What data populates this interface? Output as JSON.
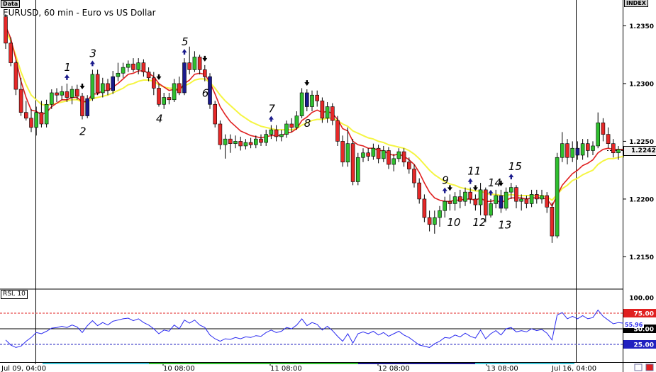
{
  "window": {
    "data_tag": "Data",
    "index_tag": "INDEX",
    "title": "EURUSD, 60 min - Euro vs US Dollar",
    "rsi_tag": "RSI, 10",
    "current_price": "1.2242",
    "rsi_overlay_value": "55.96"
  },
  "colors": {
    "bull": "#2fbf2f",
    "bear": "#e62828",
    "highlight": "#1a1a8c",
    "ema_fast": "#e02020",
    "ema_slow": "#f5f542",
    "rsi_line": "#2a2af0",
    "rsi_75_line": "#e02020",
    "rsi_25_line": "#2020c0",
    "price_tag_bg": "#f0f0f0",
    "rsi_75_tag_bg": "#e02020",
    "rsi_50_tag_bg": "#000000",
    "rsi_25_tag_bg": "#2020c0",
    "arrow_up": "#1a1a8c",
    "arrow_down": "#000000"
  },
  "chart_data": {
    "type": "candlestick",
    "symbol": "EURUSD",
    "timeframe": "60 min",
    "ylim": [
      1.213,
      1.2365
    ],
    "price_ticks": [
      "1.2350",
      "1.2300",
      "1.2250",
      "1.2200",
      "1.2150"
    ],
    "x_labels": [
      "Jul 09, 04:00",
      "10 08:00",
      "11 08:00",
      "12 08:00",
      "13 08:00",
      "Jul 16, 04:00"
    ],
    "candles": [
      [
        1.2358,
        1.2335,
        1.236,
        1.233
      ],
      [
        1.2335,
        1.2318,
        1.234,
        1.2315
      ],
      [
        1.2318,
        1.2295,
        1.232,
        1.229
      ],
      [
        1.2295,
        1.2275,
        1.2305,
        1.2272
      ],
      [
        1.2275,
        1.227,
        1.2285,
        1.2268
      ],
      [
        1.227,
        1.2262,
        1.2278,
        1.2258
      ],
      [
        1.2262,
        1.2275,
        1.228,
        1.2255
      ],
      [
        1.2275,
        1.2265,
        1.2285,
        1.2262
      ],
      [
        1.2265,
        1.2282,
        1.2286,
        1.2262
      ],
      [
        1.2282,
        1.2292,
        1.2295,
        1.2278
      ],
      [
        1.2292,
        1.229,
        1.2296,
        1.2284
      ],
      [
        1.229,
        1.2293,
        1.2298,
        1.2286
      ],
      [
        1.2293,
        1.2288,
        1.23,
        1.2284
      ],
      [
        1.2288,
        1.2295,
        1.2298,
        1.2282
      ],
      [
        1.2295,
        1.2289,
        1.2299,
        1.2286
      ],
      [
        1.2289,
        1.2272,
        1.2292,
        1.2269
      ],
      [
        1.2272,
        1.2287,
        1.229,
        1.227
      ],
      [
        1.2287,
        1.2308,
        1.2312,
        1.2285
      ],
      [
        1.2308,
        1.2292,
        1.2312,
        1.229
      ],
      [
        1.2292,
        1.23,
        1.2305,
        1.2288
      ],
      [
        1.23,
        1.2294,
        1.2304,
        1.229
      ],
      [
        1.2294,
        1.2306,
        1.2311,
        1.2291
      ],
      [
        1.2306,
        1.2309,
        1.2318,
        1.2302
      ],
      [
        1.2309,
        1.2314,
        1.2318,
        1.2305
      ],
      [
        1.2314,
        1.2317,
        1.232,
        1.231
      ],
      [
        1.2317,
        1.2312,
        1.2322,
        1.231
      ],
      [
        1.2312,
        1.2318,
        1.2322,
        1.2308
      ],
      [
        1.2318,
        1.231,
        1.2321,
        1.2306
      ],
      [
        1.231,
        1.2305,
        1.2314,
        1.2302
      ],
      [
        1.2305,
        1.2296,
        1.231,
        1.229
      ],
      [
        1.2296,
        1.2282,
        1.23,
        1.228
      ],
      [
        1.2282,
        1.2288,
        1.2292,
        1.2278
      ],
      [
        1.2288,
        1.2286,
        1.2292,
        1.2282
      ],
      [
        1.2286,
        1.23,
        1.2304,
        1.2284
      ],
      [
        1.23,
        1.2292,
        1.2306,
        1.229
      ],
      [
        1.2292,
        1.2318,
        1.2322,
        1.229
      ],
      [
        1.2318,
        1.2312,
        1.2332,
        1.2308
      ],
      [
        1.2312,
        1.2323,
        1.2328,
        1.231
      ],
      [
        1.2323,
        1.2312,
        1.2325,
        1.2308
      ],
      [
        1.2312,
        1.2306,
        1.2316,
        1.2302
      ],
      [
        1.2306,
        1.2282,
        1.2309,
        1.2278
      ],
      [
        1.2282,
        1.2265,
        1.2285,
        1.2262
      ],
      [
        1.2265,
        1.2247,
        1.2268,
        1.2243
      ],
      [
        1.2247,
        1.2252,
        1.2256,
        1.2235
      ],
      [
        1.2252,
        1.2248,
        1.2256,
        1.224
      ],
      [
        1.2248,
        1.225,
        1.2255,
        1.2244
      ],
      [
        1.225,
        1.2246,
        1.2254,
        1.2242
      ],
      [
        1.2246,
        1.2249,
        1.2252,
        1.2243
      ],
      [
        1.2249,
        1.2247,
        1.2253,
        1.2244
      ],
      [
        1.2247,
        1.2252,
        1.2255,
        1.2244
      ],
      [
        1.2252,
        1.2249,
        1.2256,
        1.2246
      ],
      [
        1.2249,
        1.2256,
        1.226,
        1.2246
      ],
      [
        1.2256,
        1.226,
        1.2264,
        1.2252
      ],
      [
        1.226,
        1.2254,
        1.2264,
        1.225
      ],
      [
        1.2254,
        1.2256,
        1.226,
        1.225
      ],
      [
        1.2256,
        1.2265,
        1.2268,
        1.2253
      ],
      [
        1.2265,
        1.2262,
        1.227,
        1.2258
      ],
      [
        1.2262,
        1.2272,
        1.2276,
        1.226
      ],
      [
        1.2272,
        1.2292,
        1.2296,
        1.227
      ],
      [
        1.2292,
        1.228,
        1.2295,
        1.2276
      ],
      [
        1.228,
        1.229,
        1.2294,
        1.2276
      ],
      [
        1.229,
        1.2285,
        1.2294,
        1.228
      ],
      [
        1.2285,
        1.227,
        1.2288,
        1.2266
      ],
      [
        1.227,
        1.228,
        1.2284,
        1.2266
      ],
      [
        1.228,
        1.2268,
        1.2283,
        1.2264
      ],
      [
        1.2268,
        1.225,
        1.2272,
        1.2246
      ],
      [
        1.225,
        1.2232,
        1.2255,
        1.2228
      ],
      [
        1.2232,
        1.2248,
        1.2262,
        1.2228
      ],
      [
        1.2248,
        1.2215,
        1.2252,
        1.2212
      ],
      [
        1.2215,
        1.2236,
        1.224,
        1.2212
      ],
      [
        1.2236,
        1.224,
        1.2244,
        1.2232
      ],
      [
        1.224,
        1.2237,
        1.2244,
        1.2233
      ],
      [
        1.2237,
        1.2244,
        1.2248,
        1.2234
      ],
      [
        1.2244,
        1.2235,
        1.2247,
        1.2231
      ],
      [
        1.2235,
        1.2242,
        1.2246,
        1.2232
      ],
      [
        1.2242,
        1.223,
        1.2245,
        1.2226
      ],
      [
        1.223,
        1.2235,
        1.2239,
        1.2224
      ],
      [
        1.2235,
        1.2241,
        1.2244,
        1.2232
      ],
      [
        1.2241,
        1.2232,
        1.2244,
        1.2228
      ],
      [
        1.2232,
        1.2226,
        1.2236,
        1.2222
      ],
      [
        1.2226,
        1.2214,
        1.223,
        1.221
      ],
      [
        1.2214,
        1.22,
        1.2218,
        1.2196
      ],
      [
        1.22,
        1.2184,
        1.2204,
        1.218
      ],
      [
        1.2184,
        1.2178,
        1.219,
        1.2172
      ],
      [
        1.2178,
        1.2184,
        1.219,
        1.217
      ],
      [
        1.2184,
        1.219,
        1.2194,
        1.2176
      ],
      [
        1.219,
        1.2198,
        1.2202,
        1.2184
      ],
      [
        1.2198,
        1.2196,
        1.2204,
        1.219
      ],
      [
        1.2196,
        1.2202,
        1.2206,
        1.219
      ],
      [
        1.2202,
        1.2198,
        1.2208,
        1.2192
      ],
      [
        1.2198,
        1.2206,
        1.221,
        1.2194
      ],
      [
        1.2206,
        1.22,
        1.221,
        1.2196
      ],
      [
        1.22,
        1.2195,
        1.2204,
        1.219
      ],
      [
        1.2195,
        1.2208,
        1.2214,
        1.2186
      ],
      [
        1.2208,
        1.2186,
        1.221,
        1.218
      ],
      [
        1.2186,
        1.2196,
        1.22,
        1.2184
      ],
      [
        1.2196,
        1.2203,
        1.2208,
        1.2192
      ],
      [
        1.2203,
        1.2192,
        1.2208,
        1.2188
      ],
      [
        1.2192,
        1.2206,
        1.221,
        1.219
      ],
      [
        1.2206,
        1.221,
        1.2214,
        1.22
      ],
      [
        1.221,
        1.2198,
        1.2212,
        1.2192
      ],
      [
        1.2198,
        1.22,
        1.2204,
        1.219
      ],
      [
        1.22,
        1.2196,
        1.2203,
        1.2192
      ],
      [
        1.2196,
        1.2204,
        1.2208,
        1.2193
      ],
      [
        1.2204,
        1.22,
        1.2208,
        1.2196
      ],
      [
        1.22,
        1.2203,
        1.2208,
        1.2196
      ],
      [
        1.2203,
        1.2193,
        1.2206,
        1.2188
      ],
      [
        1.2193,
        1.2168,
        1.2197,
        1.2162
      ],
      [
        1.2168,
        1.2236,
        1.224,
        1.2166
      ],
      [
        1.2236,
        1.2248,
        1.2258,
        1.2232
      ],
      [
        1.2248,
        1.2236,
        1.2252,
        1.223
      ],
      [
        1.2236,
        1.2244,
        1.225,
        1.2232
      ],
      [
        1.2244,
        1.2238,
        1.225,
        1.2234
      ],
      [
        1.2238,
        1.2248,
        1.2252,
        1.2234
      ],
      [
        1.2248,
        1.2242,
        1.2252,
        1.2236
      ],
      [
        1.2242,
        1.2246,
        1.225,
        1.2238
      ],
      [
        1.2246,
        1.2266,
        1.2275,
        1.2244
      ],
      [
        1.2266,
        1.2256,
        1.227,
        1.225
      ],
      [
        1.2256,
        1.2248,
        1.2262,
        1.2244
      ],
      [
        1.2248,
        1.224,
        1.2252,
        1.2236
      ],
      [
        1.224,
        1.2243,
        1.2246,
        1.2234
      ],
      [
        1.2243,
        1.2242,
        1.2246,
        1.2236
      ]
    ],
    "highlighted_candles": [
      16,
      21,
      35,
      40,
      59,
      97,
      112
    ],
    "ema_fast": [
      1.235,
      1.2339,
      1.2321,
      1.2302,
      1.2288,
      1.2277,
      1.2276,
      1.2273,
      1.2275,
      1.228,
      1.2283,
      1.2286,
      1.2286,
      1.2288,
      1.2288,
      1.2284,
      1.2285,
      1.2291,
      1.2291,
      1.2294,
      1.2294,
      1.2297,
      1.23,
      1.2304,
      1.2308,
      1.2309,
      1.2311,
      1.2311,
      1.2309,
      1.2306,
      1.23,
      1.2297,
      1.2294,
      1.2295,
      1.2294,
      1.23,
      1.2303,
      1.2308,
      1.2309,
      1.2308,
      1.2301,
      1.2291,
      1.228,
      1.2273,
      1.2267,
      1.2263,
      1.2259,
      1.2257,
      1.2255,
      1.2254,
      1.2253,
      1.2254,
      1.2255,
      1.2255,
      1.2255,
      1.2257,
      1.2258,
      1.2261,
      1.2268,
      1.2271,
      1.2275,
      1.2277,
      1.2275,
      1.2276,
      1.2274,
      1.2269,
      1.2261,
      1.2259,
      1.225,
      1.2247,
      1.2246,
      1.2244,
      1.2244,
      1.2242,
      1.2242,
      1.2239,
      1.2238,
      1.2239,
      1.2237,
      1.2234,
      1.223,
      1.2223,
      1.2214,
      1.2206,
      1.2201,
      1.2199,
      1.2198,
      1.2198,
      1.2199,
      1.2199,
      1.22,
      1.22,
      1.2199,
      1.2201,
      1.2198,
      1.2198,
      1.2199,
      1.2197,
      1.2199,
      1.2201,
      1.2201,
      1.2201,
      1.22,
      1.2201,
      1.2201,
      1.2201,
      1.22,
      1.2194,
      1.2203,
      1.2212,
      1.2217,
      1.2222,
      1.2225,
      1.2229,
      1.2231,
      1.2234,
      1.224,
      1.2243,
      1.2244,
      1.2243,
      1.2243,
      1.2243
    ],
    "ema_slow": [
      1.2345,
      1.2337,
      1.2324,
      1.231,
      1.2299,
      1.229,
      1.2286,
      1.2282,
      1.2281,
      1.2282,
      1.2283,
      1.2284,
      1.2285,
      1.2286,
      1.2286,
      1.2284,
      1.2284,
      1.2287,
      1.2288,
      1.2289,
      1.229,
      1.2292,
      1.2294,
      1.2296,
      1.2299,
      1.23,
      1.2302,
      1.2303,
      1.2303,
      1.2302,
      1.2299,
      1.2297,
      1.2296,
      1.2296,
      1.2295,
      1.2298,
      1.23,
      1.2303,
      1.2304,
      1.2304,
      1.2301,
      1.2296,
      1.229,
      1.2285,
      1.2281,
      1.2277,
      1.2273,
      1.227,
      1.2267,
      1.2265,
      1.2263,
      1.2262,
      1.2261,
      1.226,
      1.226,
      1.226,
      1.226,
      1.2261,
      1.2264,
      1.2266,
      1.2268,
      1.2269,
      1.2269,
      1.227,
      1.227,
      1.2268,
      1.2265,
      1.2263,
      1.2259,
      1.2257,
      1.2255,
      1.2253,
      1.2252,
      1.225,
      1.2249,
      1.2247,
      1.2246,
      1.2245,
      1.2244,
      1.2242,
      1.2239,
      1.2235,
      1.223,
      1.2225,
      1.2221,
      1.2218,
      1.2215,
      1.2213,
      1.2212,
      1.221,
      1.2209,
      1.2208,
      1.2207,
      1.2207,
      1.2205,
      1.2204,
      1.2204,
      1.2203,
      1.2203,
      1.2204,
      1.2203,
      1.2203,
      1.2203,
      1.2203,
      1.2203,
      1.2203,
      1.2202,
      1.2199,
      1.2204,
      1.2209,
      1.2212,
      1.2216,
      1.2218,
      1.2221,
      1.2223,
      1.2225,
      1.223,
      1.2233,
      1.2235,
      1.2235,
      1.2236,
      1.2237
    ],
    "markers": [
      {
        "label": "1",
        "index": 12,
        "dir": "up"
      },
      {
        "label": "2",
        "index": 15,
        "dir": "down"
      },
      {
        "label": "3",
        "index": 17,
        "dir": "up"
      },
      {
        "label": "4",
        "index": 30,
        "dir": "down"
      },
      {
        "label": "5",
        "index": 35,
        "dir": "up"
      },
      {
        "label": "6",
        "index": 39,
        "dir": "down"
      },
      {
        "label": "7",
        "index": 52,
        "dir": "up"
      },
      {
        "label": "8",
        "index": 59,
        "dir": "down"
      },
      {
        "label": "9",
        "index": 86,
        "dir": "up"
      },
      {
        "label": "10",
        "index": 87,
        "dir": "down"
      },
      {
        "label": "11",
        "index": 91,
        "dir": "up"
      },
      {
        "label": "12",
        "index": 92,
        "dir": "down"
      },
      {
        "label": "13",
        "index": 97,
        "dir": "down"
      },
      {
        "label": "14",
        "index": 95,
        "dir": "up"
      },
      {
        "label": "15",
        "index": 99,
        "dir": "up"
      }
    ],
    "rsi": {
      "period": 10,
      "ylim": [
        0,
        100
      ],
      "ticks": [
        "100.00",
        "75.00",
        "50.00",
        "25.00"
      ],
      "levels": [
        75,
        50,
        25
      ],
      "values": [
        32,
        24,
        20,
        22,
        30,
        36,
        44,
        42,
        46,
        51,
        52,
        54,
        52,
        56,
        53,
        44,
        55,
        63,
        55,
        60,
        56,
        62,
        64,
        66,
        67,
        63,
        66,
        60,
        56,
        50,
        42,
        48,
        46,
        56,
        50,
        64,
        59,
        64,
        56,
        52,
        40,
        34,
        30,
        34,
        33,
        36,
        34,
        37,
        36,
        39,
        38,
        44,
        48,
        44,
        46,
        52,
        50,
        56,
        66,
        55,
        60,
        57,
        48,
        54,
        47,
        38,
        30,
        42,
        27,
        42,
        45,
        42,
        46,
        40,
        44,
        38,
        42,
        46,
        40,
        36,
        30,
        24,
        22,
        20,
        26,
        30,
        36,
        35,
        40,
        37,
        43,
        38,
        35,
        48,
        34,
        42,
        47,
        40,
        50,
        52,
        45,
        47,
        45,
        50,
        47,
        49,
        43,
        32,
        72,
        76,
        66,
        70,
        66,
        71,
        66,
        68,
        80,
        70,
        64,
        58,
        60,
        59
      ]
    }
  }
}
